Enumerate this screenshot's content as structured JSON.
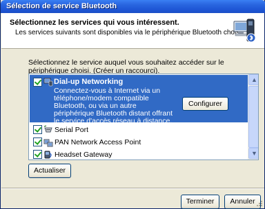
{
  "window": {
    "title": "Sélection de service Bluetooth"
  },
  "header": {
    "title": "Sélectionnez les services qui vous intéressent.",
    "subtitle": "Les services suivants sont disponibles via le périphérique Bluetooth choisi."
  },
  "instruction": "Sélectionnez le service auquel vous souhaitez accéder sur le périphérique choisi. (Créer un raccourci).",
  "services": [
    {
      "name": "Dial-up Networking",
      "description": "Connectez-vous à Internet via un téléphone/modem compatible Bluetooth, ou via un autre périphérique Bluetooth distant offrant le service d'accès réseau à distance.",
      "checked": true,
      "selected": true,
      "icon": "dialup-networking-icon"
    },
    {
      "name": "Serial Port",
      "checked": true,
      "icon": "serial-port-icon"
    },
    {
      "name": "PAN Network Access Point",
      "checked": true,
      "icon": "network-access-point-icon"
    },
    {
      "name": "Headset Gateway",
      "checked": true,
      "icon": "headset-gateway-icon"
    }
  ],
  "buttons": {
    "configure": "Configurer",
    "refresh": "Actualiser",
    "finish": "Terminer",
    "cancel": "Annuler"
  },
  "colors": {
    "titlebar": "#1f57d6",
    "selection": "#316ac5",
    "dialog_bg": "#ece9d8"
  }
}
